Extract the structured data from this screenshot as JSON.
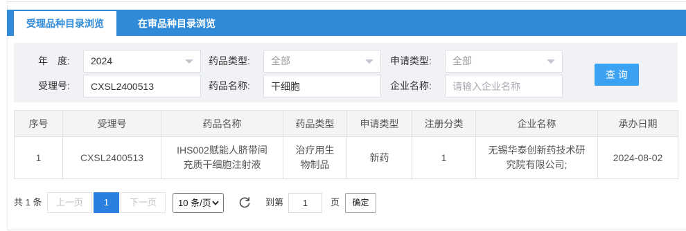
{
  "tabs": [
    {
      "label": "受理品种目录浏览",
      "active": true
    },
    {
      "label": "在审品种目录浏览",
      "active": false
    }
  ],
  "filters": {
    "year": {
      "label": "年　度:",
      "value": "2024"
    },
    "drug_type": {
      "label": "药品类型:",
      "value": "全部"
    },
    "apply_type": {
      "label": "申请类型:",
      "value": "全部"
    },
    "accept_no": {
      "label": "受理号:",
      "value": "CXSL2400513"
    },
    "drug_name": {
      "label": "药品名称:",
      "value": "干细胞"
    },
    "company": {
      "label": "企业名称:",
      "placeholder": "请输入企业名称"
    },
    "query_button": "查 询"
  },
  "table": {
    "headers": [
      "序号",
      "受理号",
      "药品名称",
      "药品类型",
      "申请类型",
      "注册分类",
      "企业名称",
      "承办日期"
    ],
    "rows": [
      [
        "1",
        "CXSL2400513",
        "IHS002赋能人脐带间充质干细胞注射液",
        "治疗用生物制品",
        "新药",
        "1",
        "无锡华泰创新药技术研究院有限公司;",
        "2024-08-02"
      ]
    ]
  },
  "pagination": {
    "total_text": "共 1 条",
    "prev": "上一页",
    "current_page": "1",
    "next": "下一页",
    "page_size": "10 条/页",
    "goto_label": "到第",
    "goto_value": "1",
    "page_unit": "页",
    "confirm": "确定"
  },
  "icons": {
    "select_arrow": "chevron-down-icon",
    "refresh": "refresh-icon"
  },
  "colors": {
    "primary": "#2f8bd8",
    "query_button": "#3ba2f3",
    "active_page": "#2b80df"
  }
}
